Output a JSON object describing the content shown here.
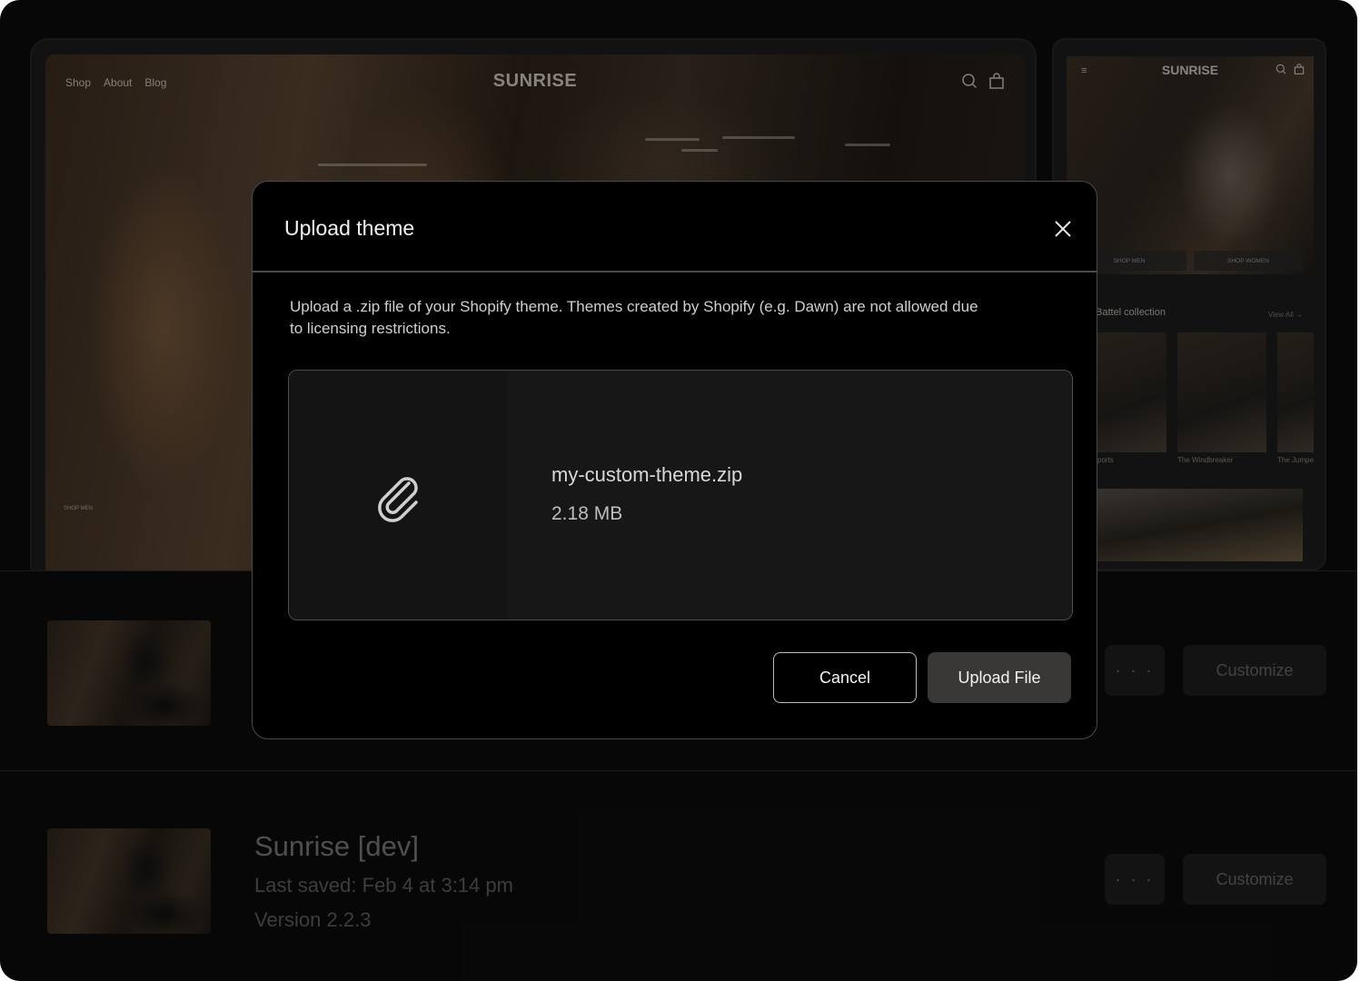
{
  "desktop_preview": {
    "nav_items": [
      "Shop",
      "About",
      "Blog"
    ],
    "logo": "SUNRISE",
    "small_label": "SHOP MEN"
  },
  "mobile_preview": {
    "menu_icon": "≡",
    "logo": "SUNRISE",
    "shop_men": "SHOP MEN",
    "shop_women": "SHOP WOMEN",
    "collection_title": "Battel collection",
    "view_all": "View All →",
    "cards": [
      "ports",
      "The Windbreaker",
      "The Jumpe"
    ]
  },
  "themes": [
    {
      "actions": {
        "more_label": "· · ·",
        "customize_label": "Customize"
      }
    },
    {
      "name": "Sunrise [dev]",
      "last_saved": "Last saved: Feb 4 at 3:14 pm",
      "version": "Version 2.2.3",
      "actions": {
        "more_label": "· · ·",
        "customize_label": "Customize"
      }
    }
  ],
  "modal": {
    "title": "Upload theme",
    "description": "Upload a .zip file of your Shopify theme. Themes created by Shopify (e.g. Dawn) are not allowed due to licensing restrictions.",
    "file": {
      "name": "my-custom-theme.zip",
      "size": "2.18 MB",
      "icon": "paperclip-icon"
    },
    "cancel_label": "Cancel",
    "upload_label": "Upload File"
  }
}
